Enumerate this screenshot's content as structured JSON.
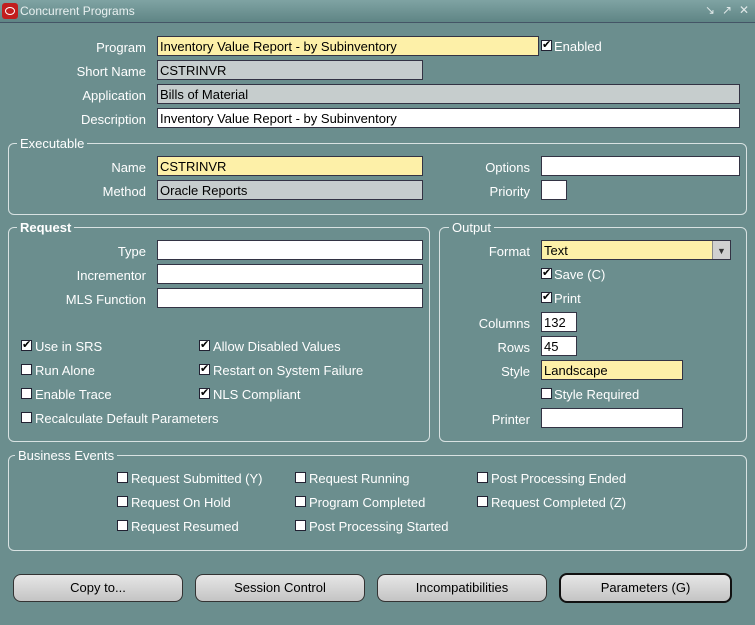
{
  "window": {
    "title": "Concurrent Programs"
  },
  "header": {
    "program_label": "Program",
    "program_value": "Inventory Value Report - by Subinventory",
    "enabled_label": "Enabled",
    "short_name_label": "Short Name",
    "short_name_value": "CSTRINVR",
    "application_label": "Application",
    "application_value": "Bills of Material",
    "description_label": "Description",
    "description_value": "Inventory Value Report - by Subinventory"
  },
  "executable": {
    "title": "Executable",
    "name_label": "Name",
    "name_value": "CSTRINVR",
    "method_label": "Method",
    "method_value": "Oracle Reports",
    "options_label": "Options",
    "options_value": "",
    "priority_label": "Priority",
    "priority_value": ""
  },
  "request": {
    "title": "Request",
    "type_label": "Type",
    "incrementor_label": "Incrementor",
    "mls_label": "MLS Function",
    "use_in_srs": "Use in SRS",
    "run_alone": "Run Alone",
    "enable_trace": "Enable Trace",
    "recalc": "Recalculate Default Parameters",
    "allow_disabled": "Allow Disabled Values",
    "restart": "Restart on System Failure",
    "nls": "NLS Compliant"
  },
  "output": {
    "title": "Output",
    "format_label": "Format",
    "format_value": "Text",
    "save_label": "Save (C)",
    "print_label": "Print",
    "columns_label": "Columns",
    "columns_value": "132",
    "rows_label": "Rows",
    "rows_value": "45",
    "style_label": "Style",
    "style_value": "Landscape",
    "style_required_label": "Style Required",
    "printer_label": "Printer",
    "printer_value": ""
  },
  "business_events": {
    "title": "Business Events",
    "request_submitted": "Request Submitted (Y)",
    "request_on_hold": "Request On Hold",
    "request_resumed": "Request Resumed",
    "request_running": "Request Running",
    "program_completed": "Program Completed",
    "post_processing_started": "Post Processing Started",
    "post_processing_ended": "Post Processing Ended",
    "request_completed": "Request Completed (Z)"
  },
  "buttons": {
    "copy_to": "Copy to...",
    "session_control": "Session Control",
    "incompatibilities": "Incompatibilities",
    "parameters": "Parameters (G)"
  },
  "checked": {
    "enabled": true,
    "use_in_srs": true,
    "run_alone": false,
    "enable_trace": false,
    "recalc": false,
    "allow_disabled": true,
    "restart": true,
    "nls": true,
    "save": true,
    "print": true,
    "style_required": false
  }
}
